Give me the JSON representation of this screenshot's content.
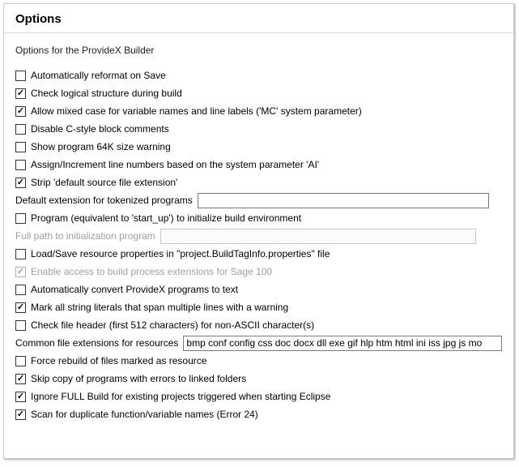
{
  "header": {
    "title": "Options"
  },
  "subtitle": "Options for the ProvideX Builder",
  "items": {
    "auto_reformat": {
      "label": "Automatically reformat on Save",
      "checked": false
    },
    "check_logical": {
      "label": "Check logical structure during build",
      "checked": true
    },
    "allow_mixed": {
      "label": "Allow mixed case for variable names and line labels ('MC' system parameter)",
      "checked": true
    },
    "disable_cstyle": {
      "label": "Disable C-style block comments",
      "checked": false
    },
    "show_64k": {
      "label": "Show program 64K size warning",
      "checked": false
    },
    "assign_inc": {
      "label": "Assign/Increment line numbers based on the system parameter 'AI'",
      "checked": false
    },
    "strip_ext": {
      "label": "Strip 'default source file extension'",
      "checked": true
    },
    "default_ext_label": "Default extension for tokenized programs",
    "default_ext_value": "",
    "program_startup": {
      "label": "Program (equivalent to 'start_up') to initialize build environment",
      "checked": false
    },
    "fullpath_label": "Full path to initialization program",
    "fullpath_value": "",
    "load_save_rsrc": {
      "label": "Load/Save resource properties in \"project.BuildTagInfo.properties\" file",
      "checked": false
    },
    "enable_sage100": {
      "label": "Enable access to build process extensions for Sage 100",
      "checked": true
    },
    "auto_convert_txt": {
      "label": "Automatically convert ProvideX programs to text",
      "checked": false
    },
    "mark_string_lit": {
      "label": "Mark all string literals that span multiple lines with a warning",
      "checked": true
    },
    "check_file_hdr": {
      "label": "Check file header (first 512 characters) for non-ASCII character(s)",
      "checked": false
    },
    "common_ext_label": "Common file extensions for resources",
    "common_ext_value": "bmp conf config css doc docx dll exe gif hlp htm html ini iss jpg js mo",
    "force_rebuild": {
      "label": "Force rebuild of files marked as resource",
      "checked": false
    },
    "skip_copy_err": {
      "label": "Skip copy of programs with errors to linked folders",
      "checked": true
    },
    "ignore_full_build": {
      "label": "Ignore FULL Build for existing projects triggered when starting Eclipse",
      "checked": true
    },
    "scan_dup": {
      "label": "Scan for duplicate function/variable names (Error 24)",
      "checked": true
    }
  }
}
